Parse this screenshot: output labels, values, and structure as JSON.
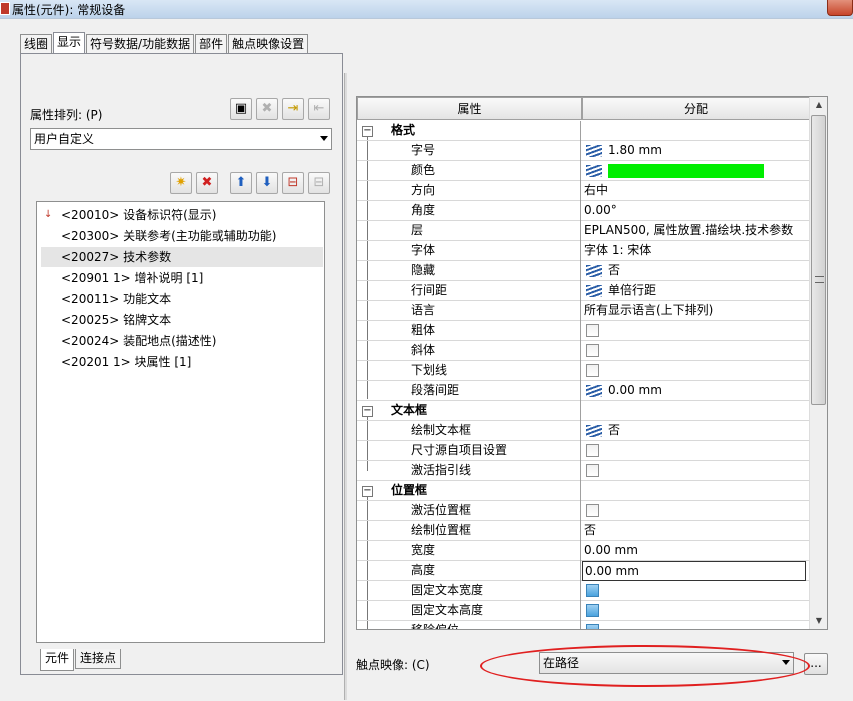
{
  "window": {
    "title": "属性(元件): 常规设备"
  },
  "tabs": [
    "线圈",
    "显示",
    "符号数据/功能数据",
    "部件",
    "触点映像设置"
  ],
  "left": {
    "sort_label": "属性排列: (P)",
    "sort_value": "用户自定义",
    "list": [
      "<20010> 设备标识符(显示)",
      "<20300> 关联参考(主功能或辅助功能)",
      "<20027> 技术参数",
      "<20901 1> 增补说明 [1]",
      "<20011> 功能文本",
      "<20025> 铭牌文本",
      "<20024> 装配地点(描述性)",
      "<20201 1> 块属性 [1]"
    ],
    "bottom_tabs": [
      "元件",
      "连接点"
    ]
  },
  "grid": {
    "col_property": "属性",
    "col_assign": "分配",
    "groups": {
      "format": "格式",
      "textbox": "文本框",
      "posbox": "位置框"
    },
    "rows": {
      "font_size": {
        "name": "字号",
        "value": "1.80 mm"
      },
      "color": {
        "name": "颜色"
      },
      "direction": {
        "name": "方向",
        "value": "右中"
      },
      "angle": {
        "name": "角度",
        "value": "0.00°"
      },
      "layer": {
        "name": "层",
        "value": "EPLAN500, 属性放置.描绘块.技术参数"
      },
      "font": {
        "name": "字体",
        "value": "字体 1: 宋体"
      },
      "hidden": {
        "name": "隐藏",
        "value": "否"
      },
      "line_spacing": {
        "name": "行间距",
        "value": "单倍行距"
      },
      "language": {
        "name": "语言",
        "value": "所有显示语言(上下排列)"
      },
      "bold": {
        "name": "粗体"
      },
      "italic": {
        "name": "斜体"
      },
      "underline": {
        "name": "下划线"
      },
      "para_spacing": {
        "name": "段落间距",
        "value": "0.00 mm"
      },
      "draw_textbox": {
        "name": "绘制文本框",
        "value": "否"
      },
      "size_from_project": {
        "name": "尺寸源自项目设置"
      },
      "activate_leader": {
        "name": "激活指引线"
      },
      "activate_posbox": {
        "name": "激活位置框"
      },
      "draw_posbox": {
        "name": "绘制位置框",
        "value": "否"
      },
      "width": {
        "name": "宽度",
        "value": "0.00 mm"
      },
      "height": {
        "name": "高度",
        "value": "0.00 mm"
      },
      "fix_width": {
        "name": "固定文本宽度"
      },
      "fix_height": {
        "name": "固定文本高度"
      },
      "remove_offset": {
        "name": "移除偏位"
      }
    }
  },
  "contact": {
    "label": "触点映像: (C)",
    "value": "在路径",
    "more_button": "..."
  },
  "colors": {
    "color_value": "#00ee00",
    "annotation": "#e02020"
  }
}
